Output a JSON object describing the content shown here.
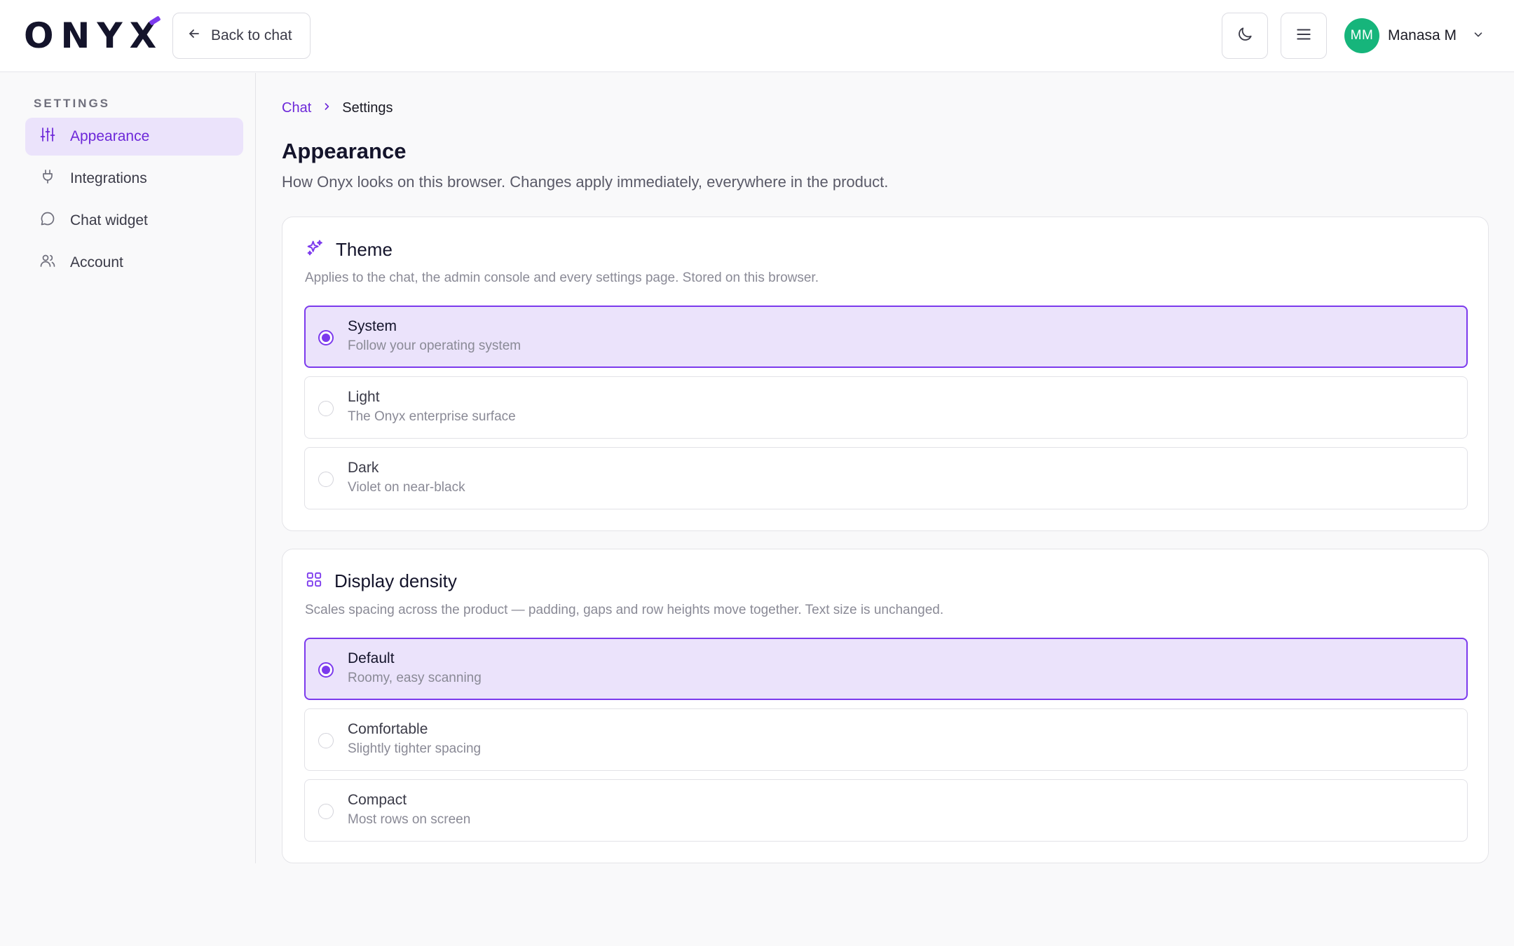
{
  "header": {
    "logo_text": "ONYX",
    "back_label": "Back to chat",
    "theme_toggle_icon": "moon-icon",
    "menu_icon": "hamburger-icon",
    "user": {
      "initials": "MM",
      "name": "Manasa M",
      "avatar_color": "#16b57b"
    }
  },
  "sidebar": {
    "title": "SETTINGS",
    "items": [
      {
        "label": "Appearance",
        "icon": "sliders-icon",
        "active": true
      },
      {
        "label": "Integrations",
        "icon": "plug-icon",
        "active": false
      },
      {
        "label": "Chat widget",
        "icon": "chat-bubble-icon",
        "active": false
      },
      {
        "label": "Account",
        "icon": "users-icon",
        "active": false
      }
    ]
  },
  "breadcrumb": {
    "parent": "Chat",
    "current": "Settings"
  },
  "page": {
    "title": "Appearance",
    "description": "How Onyx looks on this browser. Changes apply immediately, everywhere in the product."
  },
  "theme": {
    "title": "Theme",
    "icon": "sparkles-icon",
    "description": "Applies to the chat, the admin console and every settings page. Stored on this browser.",
    "options": [
      {
        "label": "System",
        "sub": "Follow your operating system",
        "selected": true
      },
      {
        "label": "Light",
        "sub": "The Onyx enterprise surface",
        "selected": false
      },
      {
        "label": "Dark",
        "sub": "Violet on near-black",
        "selected": false
      }
    ]
  },
  "density": {
    "title": "Display density",
    "icon": "grid-icon",
    "description": "Scales spacing across the product — padding, gaps and row heights move together. Text size is unchanged.",
    "options": [
      {
        "label": "Default",
        "sub": "Roomy, easy scanning",
        "selected": true
      },
      {
        "label": "Comfortable",
        "sub": "Slightly tighter spacing",
        "selected": false
      },
      {
        "label": "Compact",
        "sub": "Most rows on screen",
        "selected": false
      }
    ]
  },
  "colors": {
    "accent": "#7c3aed",
    "accent_soft": "#ebe3fb",
    "text": "#14142b",
    "muted": "#8a8a96"
  }
}
